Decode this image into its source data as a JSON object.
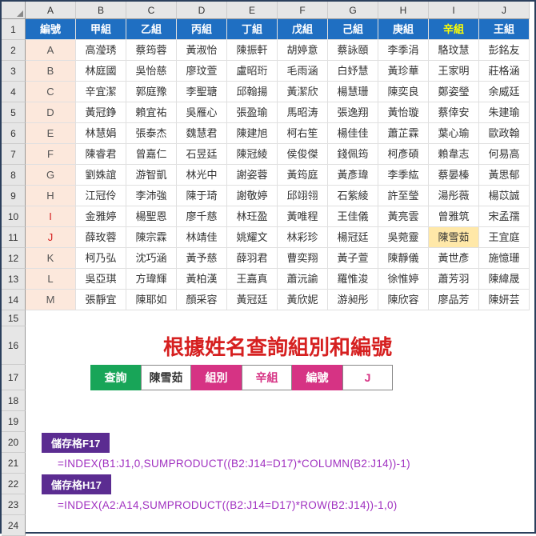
{
  "columns": [
    "A",
    "B",
    "C",
    "D",
    "E",
    "F",
    "G",
    "H",
    "I",
    "J"
  ],
  "header": {
    "id": "編號",
    "groups": [
      "甲組",
      "乙組",
      "丙組",
      "丁組",
      "戊組",
      "己組",
      "庚組",
      "辛組",
      "王組"
    ],
    "yellow_index": 7
  },
  "rows": [
    {
      "n": 2,
      "id": "A",
      "red": false,
      "v": [
        "高瀅琇",
        "蔡筠蓉",
        "黃淑怡",
        "陳振軒",
        "胡婷意",
        "蔡詠頤",
        "李季涓",
        "駱玟慧",
        "彭銘友"
      ]
    },
    {
      "n": 3,
      "id": "B",
      "red": false,
      "v": [
        "林庭國",
        "吳怡慈",
        "廖玟萱",
        "盧昭珩",
        "毛雨涵",
        "白妤慧",
        "黃珍華",
        "王家明",
        "莊格涵"
      ]
    },
    {
      "n": 4,
      "id": "C",
      "red": false,
      "v": [
        "辛宜潔",
        "郭庭豫",
        "李聖瑭",
        "邱翰揚",
        "黃潔欣",
        "楊慧珊",
        "陳奕良",
        "鄭姿瑩",
        "余威廷"
      ]
    },
    {
      "n": 5,
      "id": "D",
      "red": false,
      "v": [
        "黃冠錚",
        "賴宜祐",
        "吳雁心",
        "張盈瑜",
        "馬昭涛",
        "張逸翔",
        "黃怡璇",
        "蔡倖安",
        "朱建瑜"
      ]
    },
    {
      "n": 6,
      "id": "E",
      "red": false,
      "v": [
        "林慧娟",
        "張泰杰",
        "魏慧君",
        "陳建旭",
        "柯右笙",
        "楊佳佳",
        "蕭芷霖",
        "葉心瑜",
        "歐政翰"
      ]
    },
    {
      "n": 7,
      "id": "F",
      "red": false,
      "v": [
        "陳睿君",
        "曾嘉仁",
        "石昱廷",
        "陳冠綾",
        "侯俊傑",
        "錢佩筠",
        "柯彥碩",
        "賴韋志",
        "何易高"
      ]
    },
    {
      "n": 8,
      "id": "G",
      "red": false,
      "v": [
        "劉姝誼",
        "游智凱",
        "林光中",
        "謝姿蓉",
        "黃筠庭",
        "黃彥瑋",
        "李季紘",
        "蔡晏榛",
        "黃思郁"
      ]
    },
    {
      "n": 9,
      "id": "H",
      "red": false,
      "v": [
        "江冠伶",
        "李沛強",
        "陳于琦",
        "謝敬婷",
        "邱翊翎",
        "石紫綾",
        "許至瑩",
        "湯彤薇",
        "楊苡誠"
      ]
    },
    {
      "n": 10,
      "id": "I",
      "red": true,
      "v": [
        "金雅婷",
        "楊聖恩",
        "廖千慈",
        "林玨盈",
        "黃唯程",
        "王佳儀",
        "黃亮雲",
        "曾雅筑",
        "宋孟孺"
      ]
    },
    {
      "n": 11,
      "id": "J",
      "red": true,
      "v": [
        "薛玫蓉",
        "陳宗霖",
        "林靖佳",
        "姚耀文",
        "林彩珍",
        "楊冠廷",
        "吳菀靈",
        "陳雪茹",
        "王宜庭"
      ],
      "hl": 8
    },
    {
      "n": 12,
      "id": "K",
      "red": false,
      "v": [
        "柯乃弘",
        "沈巧涵",
        "黃予慈",
        "薛羽君",
        "曹奕翔",
        "黃子萱",
        "陳靜儀",
        "黃世彥",
        "施憶珊"
      ]
    },
    {
      "n": 13,
      "id": "L",
      "red": false,
      "v": [
        "吳亞琪",
        "方瑋輝",
        "黃柏漢",
        "王嘉真",
        "蕭沅諭",
        "羅惟浚",
        "徐惟婷",
        "蕭芳羽",
        "陳緯晟"
      ]
    },
    {
      "n": 14,
      "id": "M",
      "red": false,
      "v": [
        "張靜宜",
        "陳耶如",
        "顏采容",
        "黃冠廷",
        "黃欣妮",
        "游昶彤",
        "陳欣容",
        "廖品芳",
        "陳妍芸"
      ]
    }
  ],
  "title": "根據姓名查詢組別和編號",
  "lookup": {
    "label_search": "查詢",
    "value_search": "陳雪茹",
    "label_group": "組別",
    "value_group": "辛組",
    "label_code": "編號",
    "value_code": "J"
  },
  "formula1_label": "儲存格F17",
  "formula1": "=INDEX(B1:J1,0,SUMPRODUCT((B2:J14=D17)*COLUMN(B2:J14))-1)",
  "formula2_label": "儲存格H17",
  "formula2": "=INDEX(A2:A14,SUMPRODUCT((B2:J14=D17)*ROW(B2:J14))-1,0)"
}
